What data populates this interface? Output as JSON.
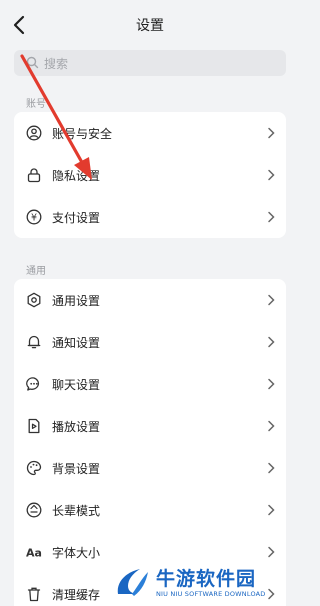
{
  "header": {
    "title": "设置"
  },
  "search": {
    "placeholder": "搜索"
  },
  "sections": {
    "account": {
      "label": "账号",
      "items": [
        "账号与安全",
        "隐私设置",
        "支付设置"
      ]
    },
    "general": {
      "label": "通用",
      "items": [
        "通用设置",
        "通知设置",
        "聊天设置",
        "播放设置",
        "背景设置",
        "长辈模式",
        "字体大小",
        "清理缓存"
      ]
    }
  },
  "icons": {
    "account": [
      "user-circle-icon",
      "lock-icon",
      "yen-circle-icon"
    ],
    "general": [
      "gear-icon",
      "bell-icon",
      "chat-bubble-icon",
      "play-file-icon",
      "palette-icon",
      "elder-mode-icon",
      "font-size-icon",
      "trash-icon"
    ]
  },
  "watermark": {
    "title": "牛游软件园",
    "subtitle": "NIU NIU SOFTWARE DOWNLOAD"
  },
  "colors": {
    "annotation_arrow": "#e23b2e",
    "watermark": "#1a66c2"
  }
}
